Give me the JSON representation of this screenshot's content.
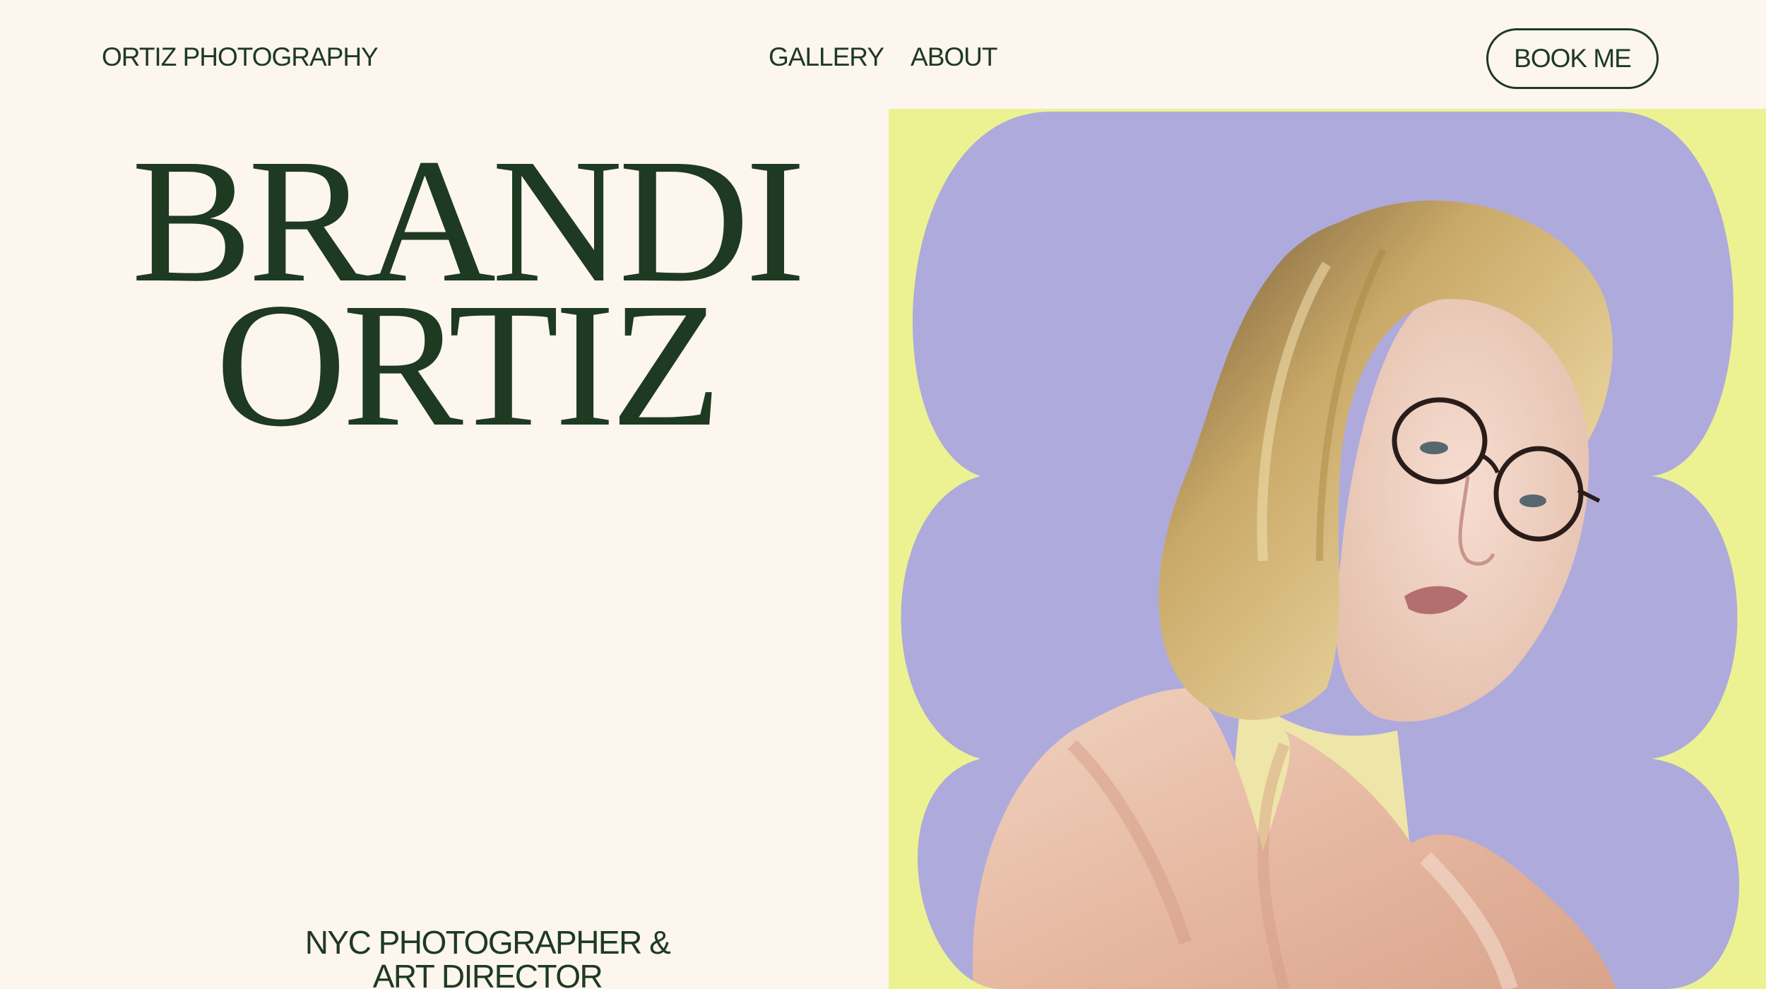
{
  "header": {
    "brand": "ORTIZ PHOTOGRAPHY",
    "nav": [
      {
        "label": "GALLERY"
      },
      {
        "label": "ABOUT"
      }
    ],
    "cta_label": "BOOK ME"
  },
  "hero": {
    "name_line1": "BRANDI",
    "name_line2": "ORTIZ",
    "tagline_line1": "NYC PHOTOGRAPHER &",
    "tagline_line2": "ART DIRECTOR"
  },
  "colors": {
    "background": "#fcf6ef",
    "text": "#1e3a22",
    "panel_yellow": "#ecf292",
    "panel_lavender": "#aeaadc"
  },
  "image": {
    "subject": "portrait-photo"
  }
}
